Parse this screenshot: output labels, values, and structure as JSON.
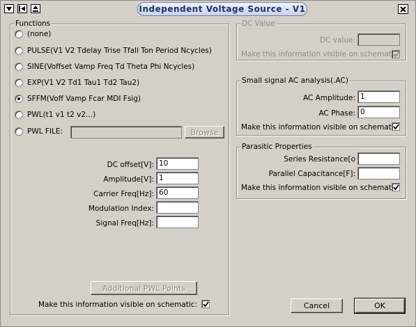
{
  "window": {
    "title": "Independent Voltage Source - V1"
  },
  "functions": {
    "group_label": "Functions",
    "options": [
      {
        "label": "(none)",
        "checked": false
      },
      {
        "label": "PULSE(V1 V2 Tdelay Trise Tfall Ton Period Ncycles)",
        "checked": false
      },
      {
        "label": "SINE(Voffset Vamp Freq Td Theta Phi Ncycles)",
        "checked": false
      },
      {
        "label": "EXP(V1 V2 Td1 Tau1 Td2 Tau2)",
        "checked": false
      },
      {
        "label": "SFFM(Voff Vamp Fcar MDI Fsig)",
        "checked": true
      },
      {
        "label": "PWL(t1 v1 t2 v2...)",
        "checked": false
      },
      {
        "label": "PWL FILE:",
        "checked": false
      }
    ],
    "pwl_file_value": "",
    "browse_label": "Browse",
    "params": [
      {
        "label": "DC offset[V]:",
        "value": "10"
      },
      {
        "label": "Amplitude[V]:",
        "value": "1"
      },
      {
        "label": "Carrier Freq[Hz]:",
        "value": "60"
      },
      {
        "label": "Modulation Index:",
        "value": ""
      },
      {
        "label": "Signal Freq[Hz]:",
        "value": ""
      }
    ],
    "additional_pwl_label": "Additional PWL Points",
    "visible_label": "Make this information visible on schematic:",
    "visible_checked": true
  },
  "dc_value": {
    "group_label": "DC Value",
    "label": "DC value:",
    "value": "",
    "visible_label": "Make this information visible on schematic:",
    "visible_checked": true
  },
  "ac": {
    "group_label": "Small signal AC analysis(.AC)",
    "amplitude_label": "AC Amplitude:",
    "amplitude_value": "1",
    "phase_label": "AC Phase:",
    "phase_value": "0",
    "visible_label": "Make this information visible on schematic:",
    "visible_checked": true
  },
  "parasitic": {
    "group_label": "Parasitic Properties",
    "series_label": "Series Resistance[o",
    "series_value": "",
    "capacitance_label": "Parallel Capacitance[F]:",
    "capacitance_value": "",
    "visible_label": "Make this information visible on schematic:",
    "visible_checked": true
  },
  "buttons": {
    "cancel": "Cancel",
    "ok": "OK"
  }
}
